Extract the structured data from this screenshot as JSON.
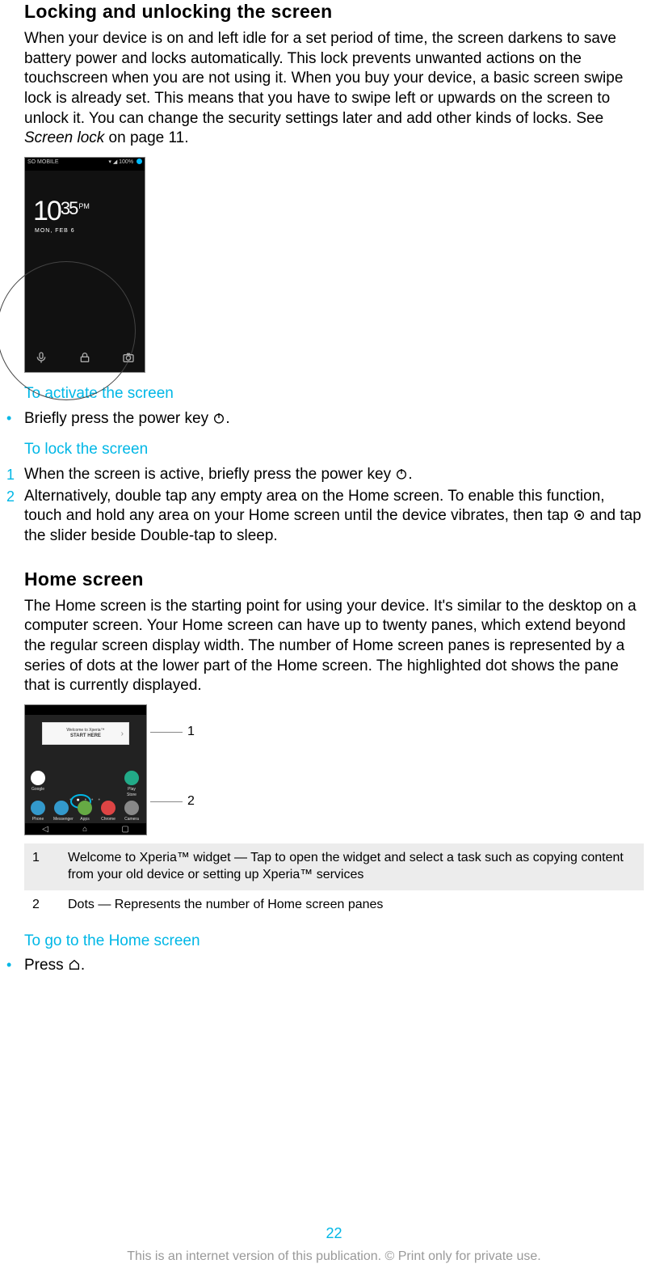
{
  "section1": {
    "title": "Locking and unlocking the screen",
    "para_a": "When your device is on and left idle for a set period of time, the screen darkens to save battery power and locks automatically. This lock prevents unwanted actions on the touchscreen when you are not using it. When you buy your device, a basic screen swipe lock is already set. This means that you have to swipe left or upwards on the screen to unlock it. You can change the security settings later and add other kinds of locks. See ",
    "para_a_em": "Screen lock",
    "para_a_tail": " on page 11."
  },
  "lockscreen": {
    "carrier": "SO MOBILE",
    "signal_icons": "▾ ◢ 100% ",
    "hour": "10",
    "minute": "35",
    "ampm": "PM",
    "date": "MON, FEB 6"
  },
  "activate": {
    "heading": "To activate the screen",
    "bullet_pre": "Briefly press the power key ",
    "bullet_post": "."
  },
  "lock": {
    "heading": "To lock the screen",
    "step1_pre": "When the screen is active, briefly press the power key ",
    "step1_post": ".",
    "step2_pre": "Alternatively, double tap any empty area on the Home screen. To enable this function, touch and hold any area on your Home screen until the device vibrates, then tap ",
    "step2_post": " and tap the slider beside Double-tap to sleep.",
    "num1": "1",
    "num2": "2"
  },
  "section2": {
    "title": "Home screen",
    "para": "The Home screen is the starting point for using your device. It's similar to the desktop on a computer screen. Your Home screen can have up to twenty panes, which extend beyond the regular screen display width. The number of Home screen panes is represented by a series of dots at the lower part of the Home screen. The highlighted dot shows the pane that is currently displayed."
  },
  "home_widget": {
    "line1": "Welcome to Xperia™",
    "line2": "START HERE"
  },
  "home_apps_row1": [
    {
      "label": "Google",
      "color": "#fff"
    },
    {
      "label": "",
      "color": ""
    },
    {
      "label": "",
      "color": ""
    },
    {
      "label": "",
      "color": ""
    },
    {
      "label": "Play Store",
      "color": "#2a8"
    }
  ],
  "home_apps_row2": [
    {
      "label": "Phone",
      "color": "#39c"
    },
    {
      "label": "Messenger",
      "color": "#39c"
    },
    {
      "label": "Apps",
      "color": "#6a4"
    },
    {
      "label": "Chrome",
      "color": "#d44"
    },
    {
      "label": "Camera",
      "color": "#888"
    }
  ],
  "callout_nums": {
    "c1": "1",
    "c2": "2"
  },
  "legend": {
    "r1n": "1",
    "r1t": "Welcome to Xperia™ widget — Tap to open the widget and select a task such as copying content from your old device or setting up Xperia™ services",
    "r2n": "2",
    "r2t": "Dots — Represents the number of Home screen panes"
  },
  "goto": {
    "heading": "To go to the Home screen",
    "bullet_pre": "Press ",
    "bullet_post": "."
  },
  "page_number": "22",
  "footer": "This is an internet version of this publication. © Print only for private use."
}
